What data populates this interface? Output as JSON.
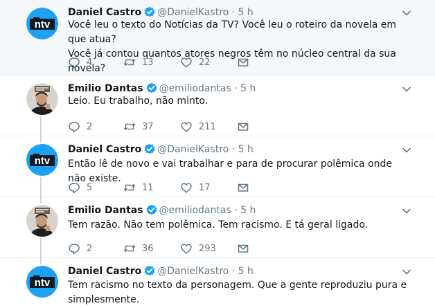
{
  "users": {
    "daniel": {
      "name": "Daniel Castro",
      "handle": "@DanielKastro",
      "avatar_label": "ntv",
      "avatar_color": "#1da1f2",
      "verified": true
    },
    "emilio": {
      "name": "Emilio Dantas",
      "handle": "@emiliodantas",
      "verified": true
    }
  },
  "tweets": [
    {
      "author": "daniel",
      "name": "Daniel Castro",
      "handle": "@DanielKastro",
      "time": "5 h",
      "lines": [
        "Você leu o texto do Notícias da TV? Você leu o roteiro da novela em que atua?",
        "Você já contou quantos atores negros têm no núcleo central da sua novela?"
      ],
      "replies": "4",
      "retweets": "13",
      "likes": "22"
    },
    {
      "author": "emilio",
      "name": "Emilio Dantas",
      "handle": "@emiliodantas",
      "time": "5 h",
      "lines": [
        "Leio. Eu trabalho, não minto."
      ],
      "replies": "2",
      "retweets": "37",
      "likes": "211"
    },
    {
      "author": "daniel",
      "name": "Daniel Castro",
      "handle": "@DanielKastro",
      "time": "5 h",
      "lines": [
        "Então lê de novo e vai trabalhar e para de procurar polêmica onde não existe."
      ],
      "replies": "5",
      "retweets": "11",
      "likes": "17"
    },
    {
      "author": "emilio",
      "name": "Emilio Dantas",
      "handle": "@emiliodantas",
      "time": "5 h",
      "lines": [
        "Tem razão. Não tem polêmica. Tem racismo. E tá geral ligado."
      ],
      "replies": "2",
      "retweets": "36",
      "likes": "293"
    },
    {
      "author": "daniel",
      "name": "Daniel Castro",
      "handle": "@DanielKastro",
      "time": "5 h",
      "lines": [
        "Tem racismo no texto da personagem. Que a gente reproduziu pura e",
        "simplesmente."
      ]
    }
  ],
  "colors": {
    "accent": "#1da1f2",
    "muted": "#657786",
    "text": "#14171a",
    "highlight_bg": "#f5f8fa",
    "divider": "#e6ecf0"
  },
  "icons": {
    "reply": "reply-icon",
    "retweet": "retweet-icon",
    "like": "heart-icon",
    "message": "envelope-icon",
    "verified": "verified-badge-icon",
    "caret": "chevron-down-icon"
  }
}
